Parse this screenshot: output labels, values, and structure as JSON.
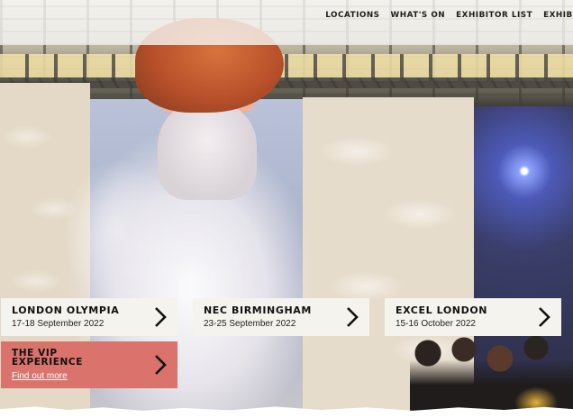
{
  "nav": {
    "items": [
      "LOCATIONS",
      "WHAT'S ON",
      "EXHIBITOR LIST",
      "EXHIBIT"
    ]
  },
  "venues": [
    {
      "name": "LONDON OLYMPIA",
      "dates": "17-18 September 2022"
    },
    {
      "name": "NEC BIRMINGHAM",
      "dates": "23-25 September 2022"
    },
    {
      "name": "EXCEL LONDON",
      "dates": "15-16 October 2022"
    }
  ],
  "vip": {
    "title": "THE VIP EXPERIENCE",
    "link_label": "Find out more"
  },
  "colors": {
    "card_bg": "#f4f3ee",
    "vip_bg": "#d9736b",
    "header_bg": "#f5f4f0"
  },
  "icons": {
    "card_arrow": "chevron-right-icon"
  }
}
